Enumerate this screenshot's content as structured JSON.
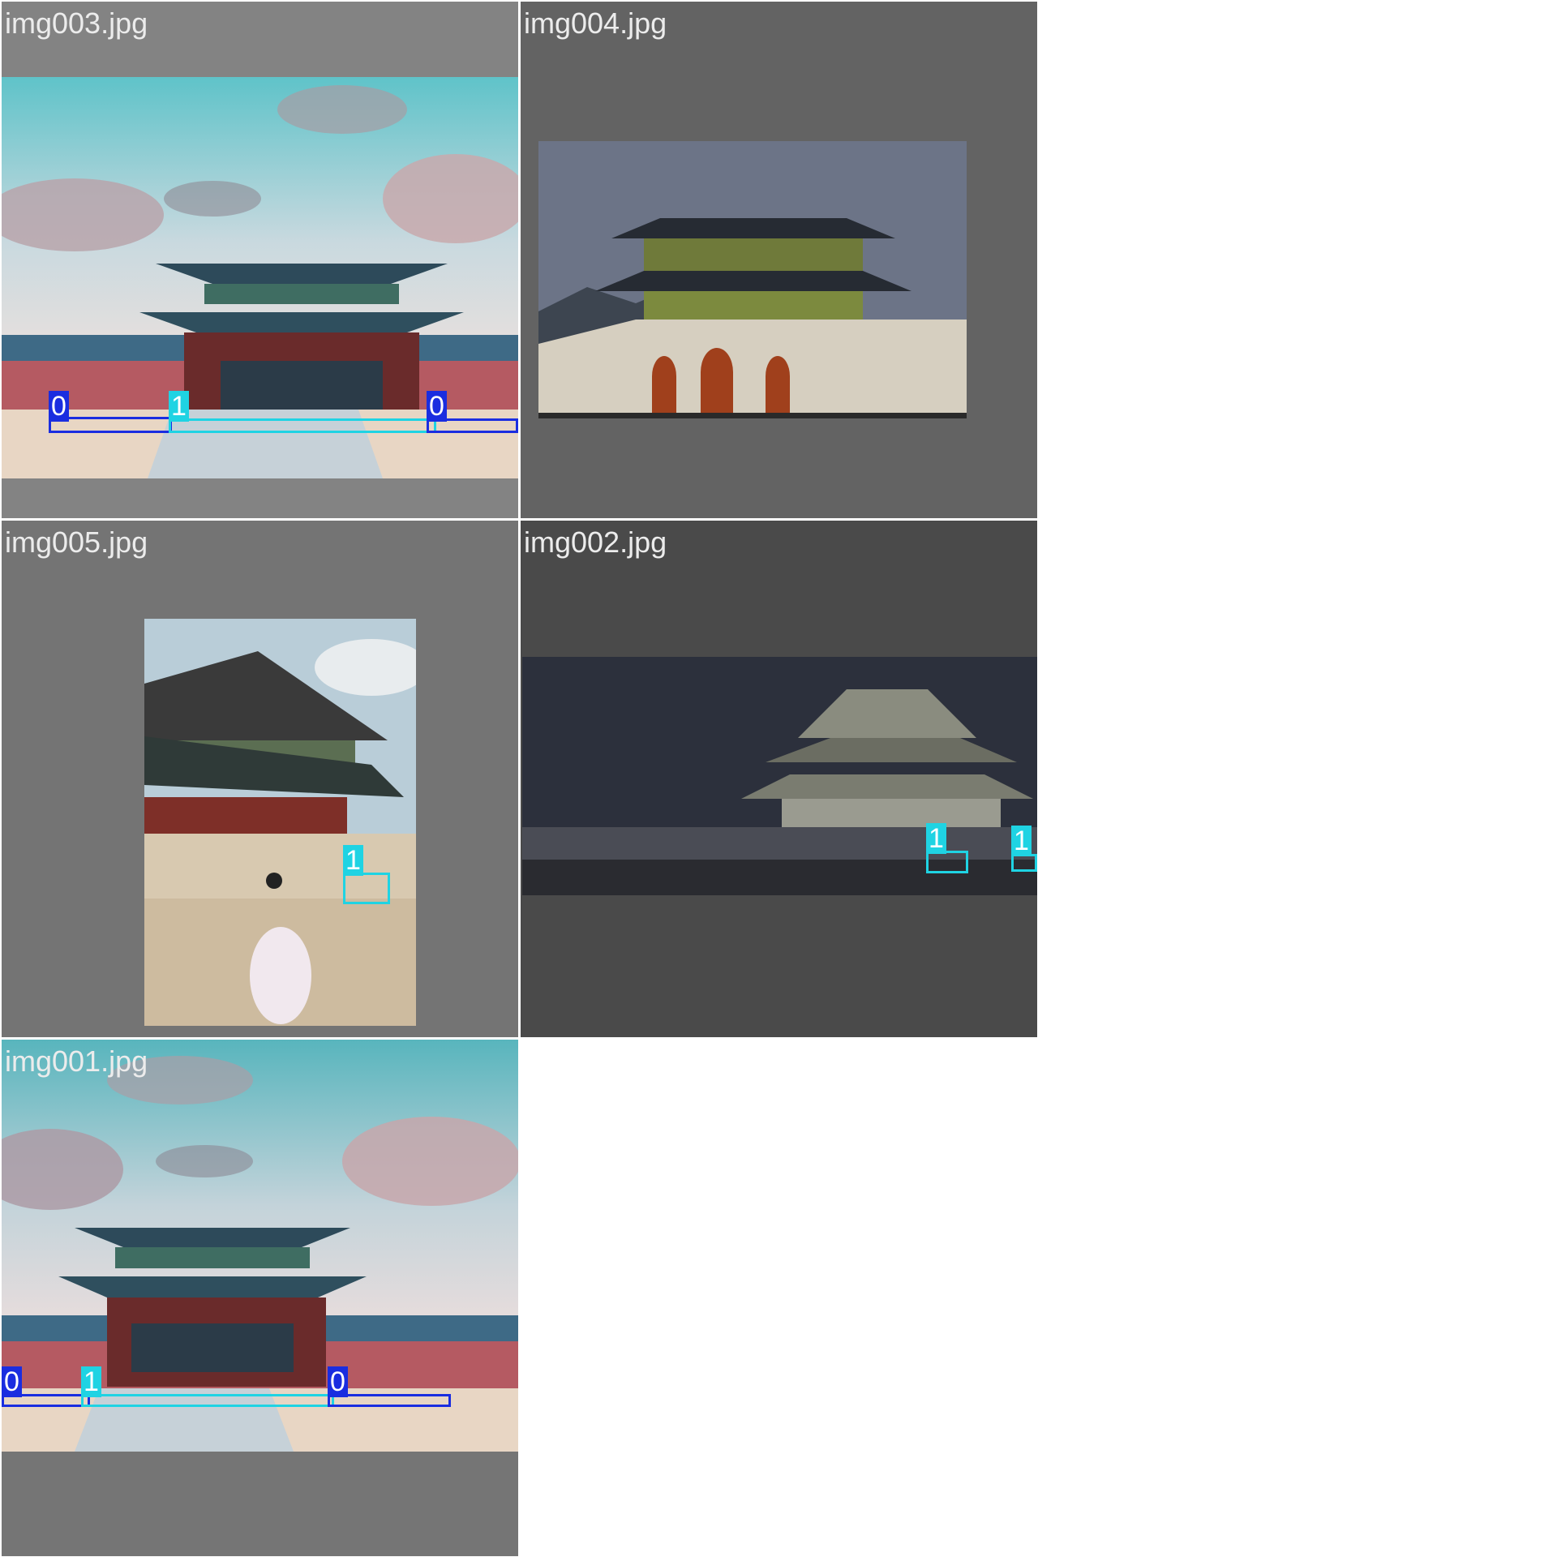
{
  "tiles": [
    {
      "filename": "img003.jpg",
      "labels": [
        "0",
        "1",
        "0"
      ]
    },
    {
      "filename": "img004.jpg",
      "labels": []
    },
    {
      "filename": "img005.jpg",
      "labels": [
        "1"
      ]
    },
    {
      "filename": "img002.jpg",
      "labels": [
        "1",
        "1"
      ]
    },
    {
      "filename": "img001.jpg",
      "labels": [
        "0",
        "1",
        "0"
      ]
    }
  ],
  "colors": {
    "class_0": "#1a2de0",
    "class_1": "#1fd3e3"
  }
}
